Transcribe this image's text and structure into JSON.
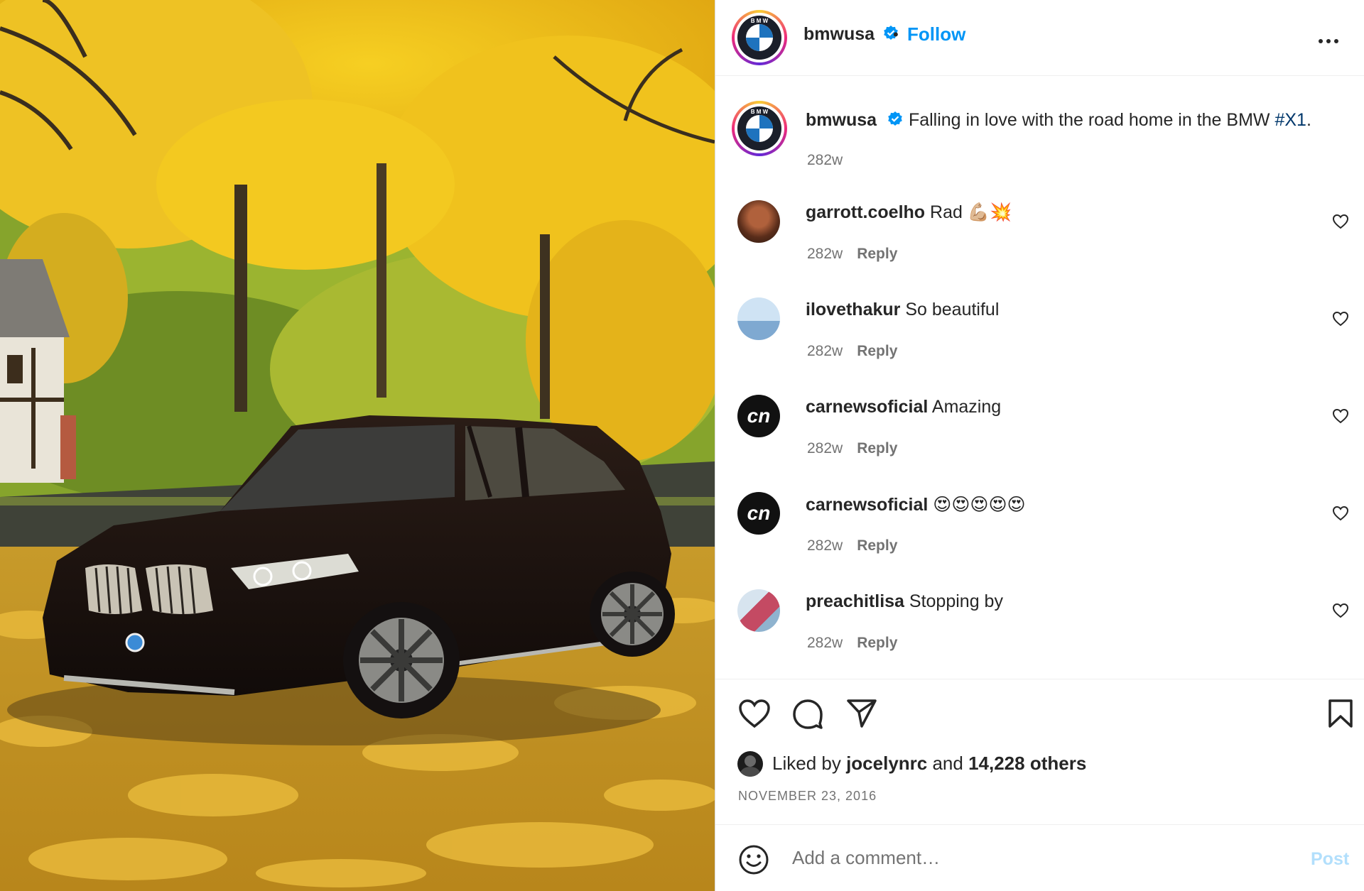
{
  "header": {
    "username": "bmwusa",
    "separator": "•",
    "follow_label": "Follow",
    "more_icon": "more-horizontal-icon"
  },
  "caption": {
    "username": "bmwusa",
    "text": "Falling in love with the road home in the BMW ",
    "hashtag": "#X1",
    "text_end": ".",
    "time": "282w"
  },
  "comments": [
    {
      "username": "garrott.coelho",
      "text": "Rad 💪🏼💥",
      "time": "282w",
      "reply": "Reply"
    },
    {
      "username": "ilovethakur",
      "text": "So beautiful",
      "time": "282w",
      "reply": "Reply"
    },
    {
      "username": "carnewsoficial",
      "text": "Amazing",
      "time": "282w",
      "reply": "Reply"
    },
    {
      "username": "carnewsoficial",
      "text": "😍😍😍😍😍",
      "time": "282w",
      "reply": "Reply"
    },
    {
      "username": "preachitlisa",
      "text": "Stopping by",
      "time": "282w",
      "reply": "Reply"
    }
  ],
  "actions": {
    "like_icon": "heart-icon",
    "comment_icon": "comment-bubble-icon",
    "share_icon": "send-icon",
    "save_icon": "bookmark-icon"
  },
  "likes": {
    "prefix": "Liked by ",
    "user": "jocelynrc",
    "middle": " and ",
    "count": "14,228 others"
  },
  "date": "NOVEMBER 23, 2016",
  "composer": {
    "placeholder": "Add a comment…",
    "post_label": "Post",
    "emoji_icon": "emoji-smiley-icon"
  },
  "colors": {
    "accent": "#0095f6",
    "post_disabled": "#b2dffc",
    "hashtag": "#00376b",
    "muted": "#737373"
  }
}
